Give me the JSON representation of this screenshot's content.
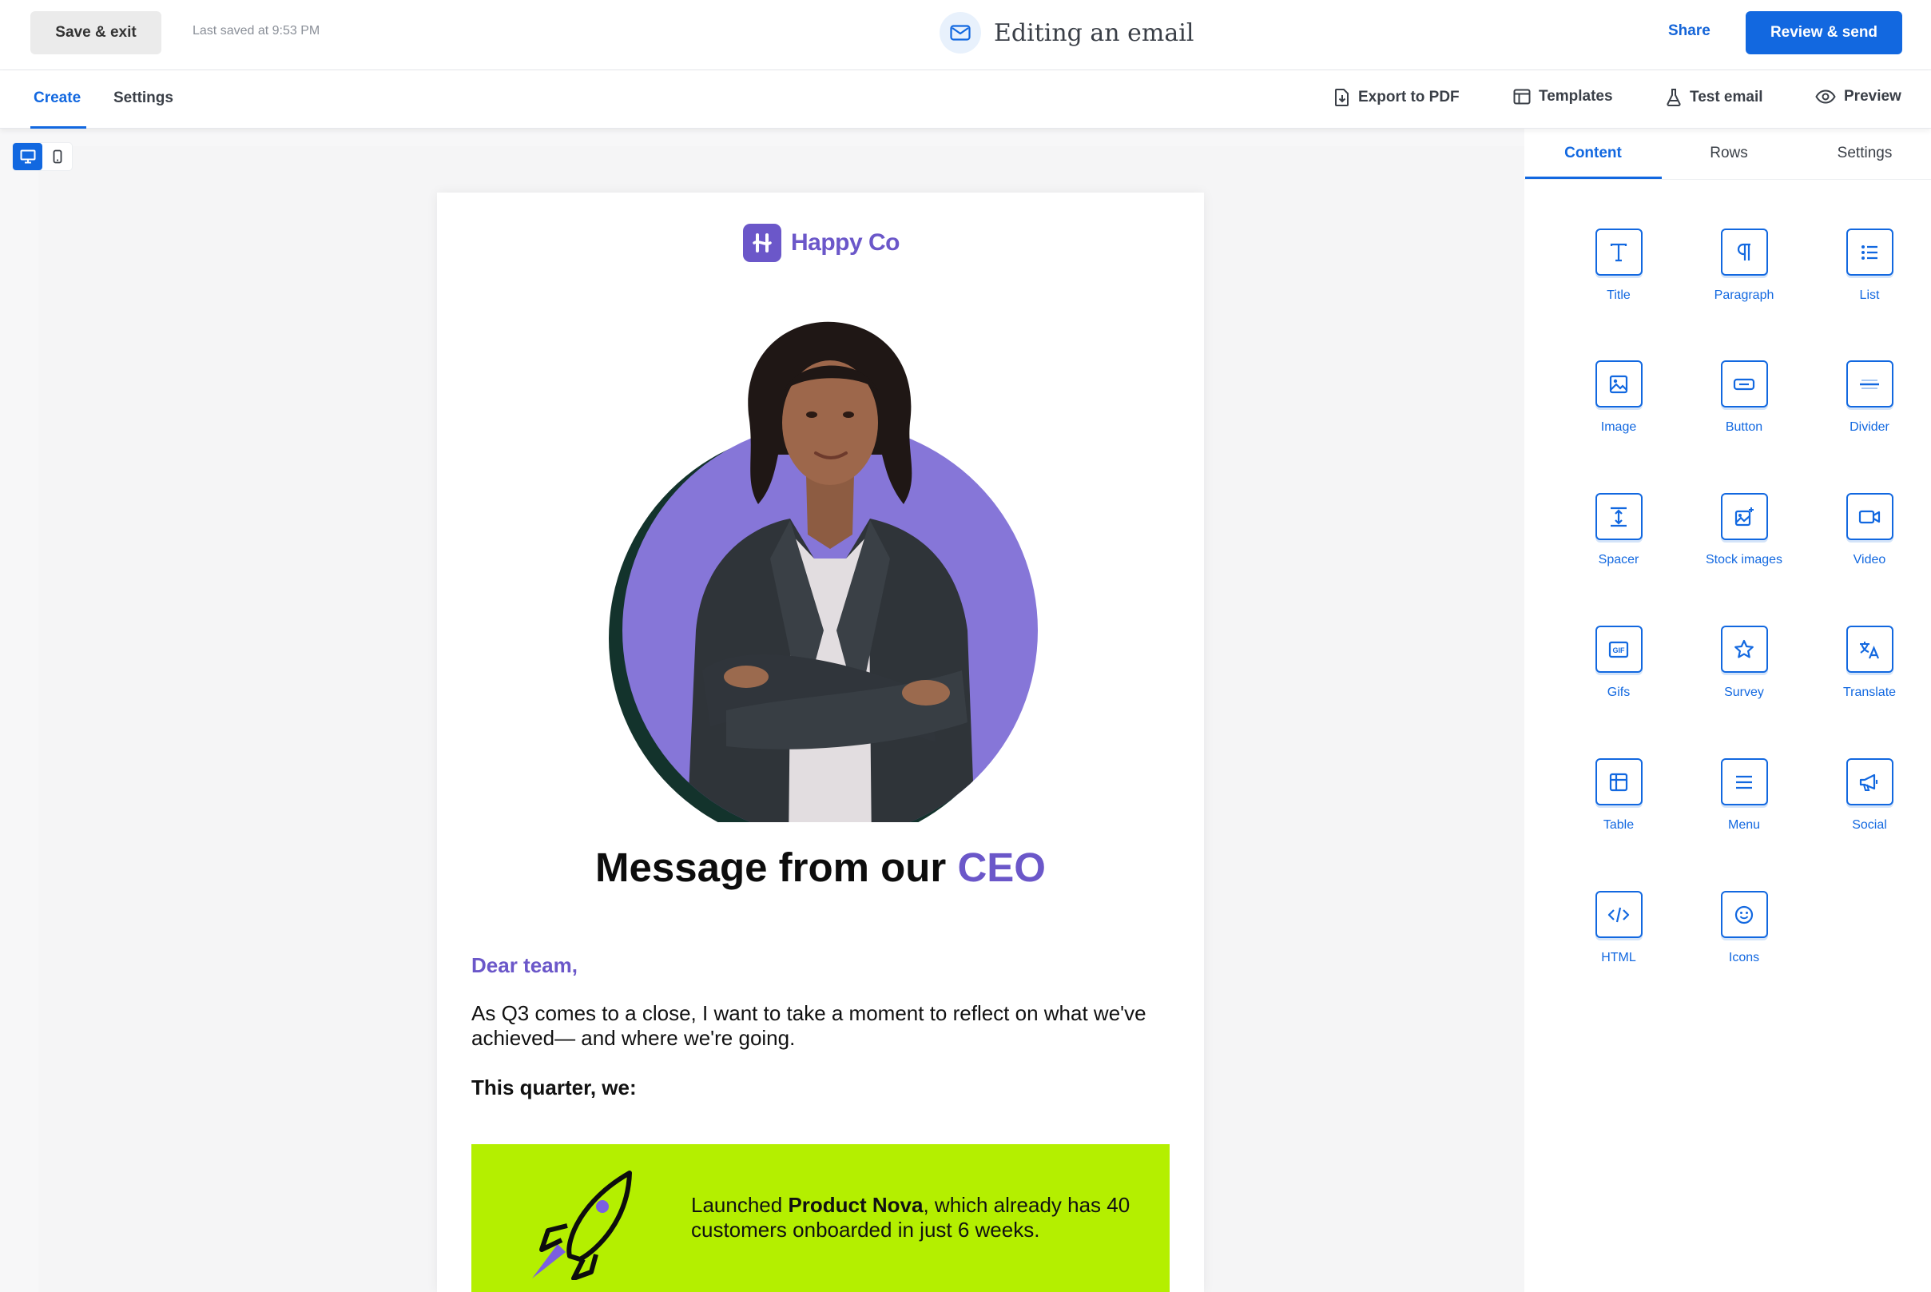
{
  "topbar": {
    "save_exit_label": "Save & exit",
    "last_saved": "Last saved at 9:53 PM",
    "title": "Editing an email",
    "share_label": "Share",
    "review_label": "Review & send"
  },
  "subnav": {
    "tabs": [
      {
        "label": "Create",
        "active": true
      },
      {
        "label": "Settings",
        "active": false
      }
    ],
    "tools": [
      {
        "label": "Export to PDF",
        "icon": "file-download-icon"
      },
      {
        "label": "Templates",
        "icon": "template-icon"
      },
      {
        "label": "Test email",
        "icon": "flask-icon"
      },
      {
        "label": "Preview",
        "icon": "eye-icon"
      }
    ]
  },
  "canvas": {
    "device_modes": [
      {
        "name": "desktop",
        "icon": "desktop-icon",
        "active": true
      },
      {
        "name": "mobile",
        "icon": "mobile-icon",
        "active": false
      }
    ]
  },
  "email": {
    "brand": "Happy Co",
    "headline_main": "Message from our",
    "headline_accent": "CEO",
    "greeting": "Dear team,",
    "body": "As Q3 comes to a close, I want to take a moment to reflect on what we've achieved— and where we're going.",
    "subheading": "This quarter, we:",
    "highlight": {
      "prefix": "Launched ",
      "emphasis": "Product Nova",
      "suffix": ", which already has 40 customers onboarded in just 6 weeks."
    },
    "colors": {
      "brand_purple": "#6b57c9",
      "highlight_green": "#b4ef00"
    }
  },
  "panel": {
    "tabs": [
      {
        "label": "Content",
        "active": true
      },
      {
        "label": "Rows",
        "active": false
      },
      {
        "label": "Settings",
        "active": false
      }
    ],
    "blocks": [
      {
        "label": "Title",
        "icon": "title-icon"
      },
      {
        "label": "Paragraph",
        "icon": "paragraph-icon"
      },
      {
        "label": "List",
        "icon": "list-icon"
      },
      {
        "label": "Image",
        "icon": "image-icon"
      },
      {
        "label": "Button",
        "icon": "button-icon"
      },
      {
        "label": "Divider",
        "icon": "divider-icon"
      },
      {
        "label": "Spacer",
        "icon": "spacer-icon"
      },
      {
        "label": "Stock images",
        "icon": "stock-images-icon"
      },
      {
        "label": "Video",
        "icon": "video-icon"
      },
      {
        "label": "Gifs",
        "icon": "gif-icon"
      },
      {
        "label": "Survey",
        "icon": "star-icon"
      },
      {
        "label": "Translate",
        "icon": "translate-icon"
      },
      {
        "label": "Table",
        "icon": "table-icon"
      },
      {
        "label": "Menu",
        "icon": "menu-icon"
      },
      {
        "label": "Social",
        "icon": "megaphone-icon"
      },
      {
        "label": "HTML",
        "icon": "code-icon"
      },
      {
        "label": "Icons",
        "icon": "smiley-icon"
      }
    ],
    "accent_color": "#1268e0"
  }
}
